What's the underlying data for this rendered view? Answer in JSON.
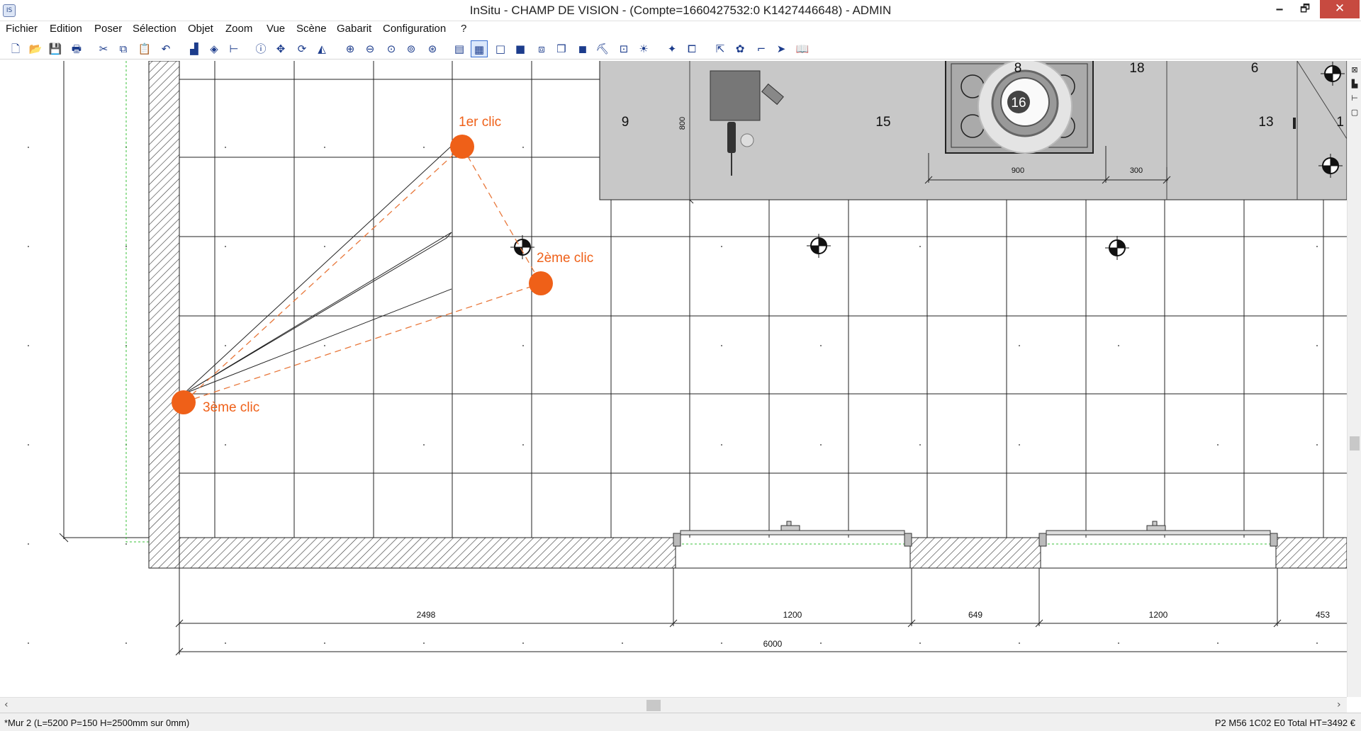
{
  "window": {
    "title": "InSitu - CHAMP DE VISION - (Compte=1660427532:0 K1427446648) - ADMIN",
    "app_icon_label": "IS",
    "minimize": "🗕",
    "maximize": "🗗",
    "close": "✕"
  },
  "menu": {
    "items": [
      "Fichier",
      "Edition",
      "Poser",
      "Sélection",
      "Objet",
      "Zoom",
      "Vue",
      "Scène",
      "Gabarit",
      "Configuration",
      "?"
    ]
  },
  "toolbar": {
    "icons": [
      "new-file-icon",
      "open-folder-icon",
      "save-icon",
      "print-icon",
      "cut-icon",
      "copy-icon",
      "paste-icon",
      "undo-icon",
      "stairs-icon",
      "sketchup-icon",
      "measure-icon",
      "info-icon",
      "move-icon",
      "rotate-icon",
      "mirror-icon",
      "zoom-in-icon",
      "zoom-out-icon",
      "zoom-window-icon",
      "zoom-fit-icon",
      "zoom-previous-icon",
      "layers-icon",
      "plan-view-icon",
      "frame-view-icon",
      "fill-view-icon",
      "box-view-icon",
      "cube-view-icon",
      "solid-view-icon",
      "camera-icon",
      "camera-photo-icon",
      "light-icon",
      "wand-icon",
      "box-group-icon",
      "export-icon",
      "palette-icon",
      "line-tool-icon",
      "arrow-tool-icon",
      "catalog-icon"
    ]
  },
  "plan": {
    "annotations": {
      "click1": "1er clic",
      "click2": "2ème clic",
      "click3": "3ème clic"
    },
    "colors": {
      "click_marker": "#ef6018",
      "dashed_line": "#e8773a",
      "counter": "#c8c8c8",
      "green_guide": "#3ac03a"
    },
    "element_numbers": {
      "e9": "9",
      "e15": "15",
      "e8": "8",
      "e18": "18",
      "e6": "6",
      "e16": "16",
      "e13": "13",
      "e1": "1"
    },
    "counter_dims": {
      "depth": "800",
      "hob": "900",
      "side": "300"
    },
    "dimensions": {
      "d1": "2498",
      "d2": "1200",
      "d3": "649",
      "d4": "1200",
      "d5": "453",
      "total": "6000"
    }
  },
  "statusbar": {
    "left": "*Mur 2  (L=5200 P=150 H=2500mm sur 0mm)",
    "right": "P2 M56  1C02 E0 Total HT=3492 €"
  }
}
